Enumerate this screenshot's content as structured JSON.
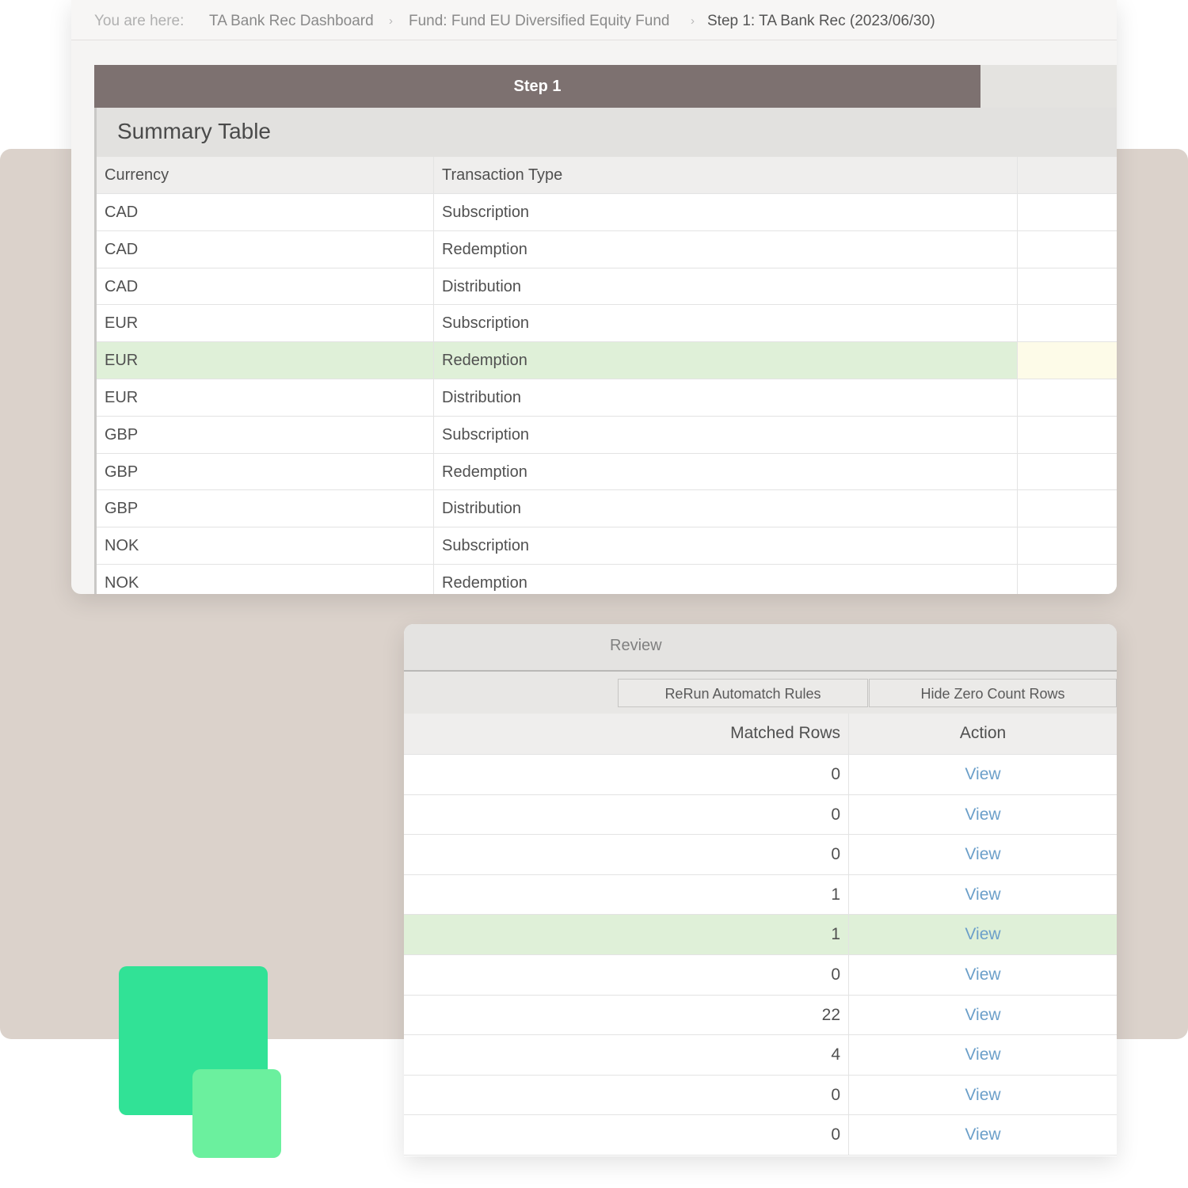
{
  "breadcrumb": {
    "lead": "You are here:",
    "items": [
      "TA Bank Rec Dashboard",
      "Fund: Fund EU Diversified Equity Fund",
      "Step 1: TA Bank Rec (2023/06/30)"
    ],
    "separator": "›"
  },
  "step_tab": {
    "label": "Step 1"
  },
  "summary": {
    "title": "Summary Table",
    "columns": [
      "Currency",
      "Transaction Type"
    ],
    "rows": [
      {
        "currency": "CAD",
        "type": "Subscription"
      },
      {
        "currency": "CAD",
        "type": "Redemption"
      },
      {
        "currency": "CAD",
        "type": "Distribution"
      },
      {
        "currency": "EUR",
        "type": "Subscription"
      },
      {
        "currency": "EUR",
        "type": "Redemption"
      },
      {
        "currency": "EUR",
        "type": "Distribution"
      },
      {
        "currency": "GBP",
        "type": "Subscription"
      },
      {
        "currency": "GBP",
        "type": "Redemption"
      },
      {
        "currency": "GBP",
        "type": "Distribution"
      },
      {
        "currency": "NOK",
        "type": "Subscription"
      },
      {
        "currency": "NOK",
        "type": "Redemption"
      }
    ],
    "selected_index": 4
  },
  "review": {
    "title": "Review",
    "buttons": {
      "rerun": "ReRun Automatch Rules",
      "hide_zero": "Hide Zero Count Rows"
    },
    "columns": {
      "matched": "Matched Rows",
      "action": "Action"
    },
    "rows": [
      {
        "matched": "0",
        "action": "View"
      },
      {
        "matched": "0",
        "action": "View"
      },
      {
        "matched": "0",
        "action": "View"
      },
      {
        "matched": "1",
        "action": "View"
      },
      {
        "matched": "1",
        "action": "View"
      },
      {
        "matched": "0",
        "action": "View"
      },
      {
        "matched": "22",
        "action": "View"
      },
      {
        "matched": "4",
        "action": "View"
      },
      {
        "matched": "0",
        "action": "View"
      },
      {
        "matched": "0",
        "action": "View"
      }
    ],
    "selected_index": 4
  },
  "colors": {
    "tab_bg": "#7d7170",
    "selected_row": "#dff0d8",
    "link": "#6b9fc9",
    "accent_green": "#31e296",
    "accent_green_light": "#6bf09e",
    "backdrop": "#dbd2cb"
  }
}
